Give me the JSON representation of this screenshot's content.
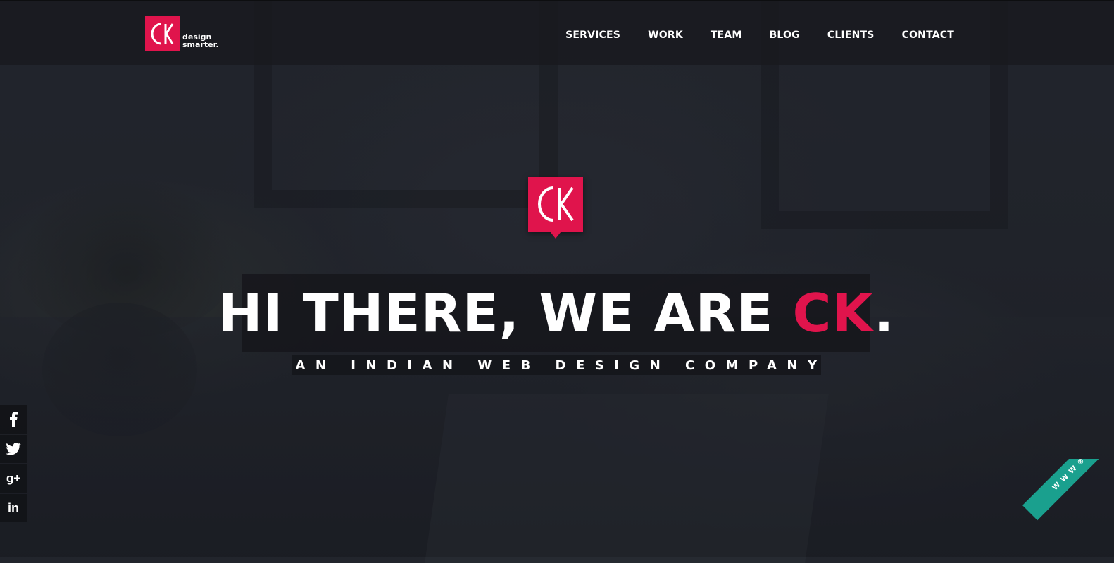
{
  "brand": {
    "tagline_line1": "design",
    "tagline_line2": "smarter.",
    "logo_icon": "ck-logo-icon",
    "color": "#e0144c"
  },
  "nav": {
    "items": [
      {
        "label": "SERVICES"
      },
      {
        "label": "WORK"
      },
      {
        "label": "TEAM"
      },
      {
        "label": "BLOG"
      },
      {
        "label": "CLIENTS"
      },
      {
        "label": "CONTACT"
      }
    ]
  },
  "hero": {
    "logo_icon": "ck-speech-bubble-logo-icon",
    "headline_prefix": "HI THERE, WE ARE ",
    "headline_accent": "CK",
    "headline_suffix": ".",
    "subheadline": "AN INDIAN WEB DESIGN COMPANY"
  },
  "social": {
    "items": [
      {
        "icon": "facebook-icon",
        "glyph": "f"
      },
      {
        "icon": "twitter-icon",
        "glyph": "🐦"
      },
      {
        "icon": "google-plus-icon",
        "glyph": "g+"
      },
      {
        "icon": "linkedin-icon",
        "glyph": "in"
      }
    ]
  },
  "ribbon": {
    "label": "W W W ® NOMINEE",
    "color": "#1aa08e"
  }
}
